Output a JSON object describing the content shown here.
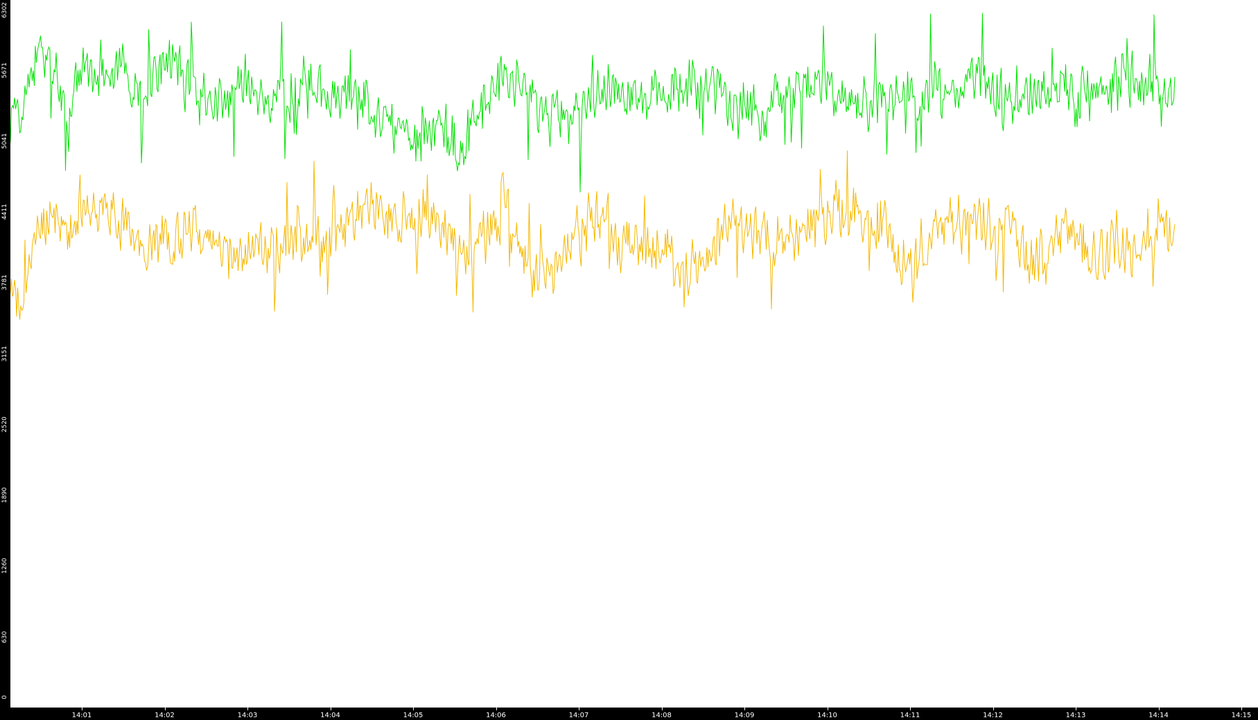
{
  "chart_data": {
    "type": "line",
    "title": "",
    "xlabel": "",
    "ylabel": "",
    "ylim": [
      0,
      6302
    ],
    "y_ticks": [
      "0",
      "630",
      "1260",
      "1890",
      "2520",
      "3151",
      "3781",
      "4411",
      "5041",
      "5671",
      "6302"
    ],
    "x_ticks": [
      "14:01",
      "14:02",
      "14:03",
      "14:04",
      "14:05",
      "14:06",
      "14:07",
      "14:08",
      "14:09",
      "14:10",
      "14:11",
      "14:12",
      "14:13",
      "14:14",
      "14:15"
    ],
    "x_start_minute": 0.0,
    "x_end_minute": 14.2,
    "grid": false,
    "legend": "none",
    "colors": {
      "axis_background": "#000000",
      "axis_text": "#ffffff",
      "plot_background": "#ffffff",
      "series_green": "#00e000",
      "series_yellow": "#f5b800"
    },
    "series": [
      {
        "color": "#00e000",
        "profile": [
          [
            0.0,
            5500
          ],
          [
            0.15,
            5300
          ],
          [
            0.3,
            5400
          ],
          [
            0.45,
            5800
          ],
          [
            0.6,
            5700
          ],
          [
            0.8,
            5450
          ],
          [
            1.0,
            5600
          ],
          [
            1.25,
            5700
          ],
          [
            1.5,
            5650
          ],
          [
            1.7,
            5400
          ],
          [
            1.9,
            5600
          ],
          [
            2.1,
            5800
          ],
          [
            2.3,
            5550
          ],
          [
            2.5,
            5350
          ],
          [
            2.7,
            5450
          ],
          [
            3.0,
            5550
          ],
          [
            3.3,
            5350
          ],
          [
            3.6,
            5550
          ],
          [
            3.9,
            5500
          ],
          [
            4.2,
            5450
          ],
          [
            4.5,
            5400
          ],
          [
            4.8,
            5150
          ],
          [
            5.0,
            5050
          ],
          [
            5.3,
            5150
          ],
          [
            5.6,
            5000
          ],
          [
            5.8,
            5350
          ],
          [
            6.1,
            5600
          ],
          [
            6.4,
            5450
          ],
          [
            6.7,
            5200
          ],
          [
            7.0,
            5300
          ],
          [
            7.2,
            5500
          ],
          [
            7.4,
            5650
          ],
          [
            7.7,
            5400
          ],
          [
            8.0,
            5450
          ],
          [
            8.3,
            5500
          ],
          [
            8.6,
            5550
          ],
          [
            8.9,
            5400
          ],
          [
            9.2,
            5300
          ],
          [
            9.5,
            5450
          ],
          [
            9.8,
            5550
          ],
          [
            10.1,
            5500
          ],
          [
            10.4,
            5450
          ],
          [
            10.7,
            5450
          ],
          [
            11.0,
            5500
          ],
          [
            11.3,
            5500
          ],
          [
            11.6,
            5550
          ],
          [
            11.9,
            5600
          ],
          [
            12.2,
            5400
          ],
          [
            12.5,
            5500
          ],
          [
            12.8,
            5450
          ],
          [
            13.1,
            5450
          ],
          [
            13.4,
            5550
          ],
          [
            13.6,
            5800
          ],
          [
            13.8,
            5500
          ],
          [
            14.0,
            5500
          ],
          [
            14.2,
            5550
          ]
        ]
      },
      {
        "color": "#f5b800",
        "profile": [
          [
            0.0,
            4150
          ],
          [
            0.15,
            3700
          ],
          [
            0.3,
            3500
          ],
          [
            0.45,
            4200
          ],
          [
            0.6,
            4400
          ],
          [
            0.8,
            4300
          ],
          [
            1.0,
            4500
          ],
          [
            1.25,
            4450
          ],
          [
            1.5,
            4350
          ],
          [
            1.7,
            4100
          ],
          [
            1.9,
            4200
          ],
          [
            2.1,
            4050
          ],
          [
            2.3,
            4350
          ],
          [
            2.5,
            4150
          ],
          [
            2.7,
            4000
          ],
          [
            3.0,
            4150
          ],
          [
            3.3,
            4050
          ],
          [
            3.6,
            4150
          ],
          [
            3.9,
            4100
          ],
          [
            4.2,
            4350
          ],
          [
            4.5,
            4500
          ],
          [
            4.8,
            4350
          ],
          [
            5.0,
            4400
          ],
          [
            5.3,
            4250
          ],
          [
            5.6,
            4050
          ],
          [
            5.8,
            4200
          ],
          [
            6.1,
            4400
          ],
          [
            6.4,
            3950
          ],
          [
            6.7,
            3800
          ],
          [
            7.0,
            4300
          ],
          [
            7.2,
            4350
          ],
          [
            7.4,
            4300
          ],
          [
            7.7,
            4050
          ],
          [
            8.0,
            4100
          ],
          [
            8.3,
            3900
          ],
          [
            8.6,
            4100
          ],
          [
            8.9,
            4350
          ],
          [
            9.2,
            4200
          ],
          [
            9.5,
            4150
          ],
          [
            9.8,
            4300
          ],
          [
            10.1,
            4400
          ],
          [
            10.4,
            4400
          ],
          [
            10.7,
            4250
          ],
          [
            11.0,
            3850
          ],
          [
            11.3,
            4300
          ],
          [
            11.6,
            4350
          ],
          [
            11.9,
            4300
          ],
          [
            12.2,
            4200
          ],
          [
            12.5,
            4000
          ],
          [
            12.8,
            4250
          ],
          [
            13.1,
            4050
          ],
          [
            13.4,
            4100
          ],
          [
            13.6,
            4000
          ],
          [
            13.8,
            4250
          ],
          [
            14.0,
            4300
          ],
          [
            14.2,
            4150
          ]
        ]
      }
    ]
  }
}
